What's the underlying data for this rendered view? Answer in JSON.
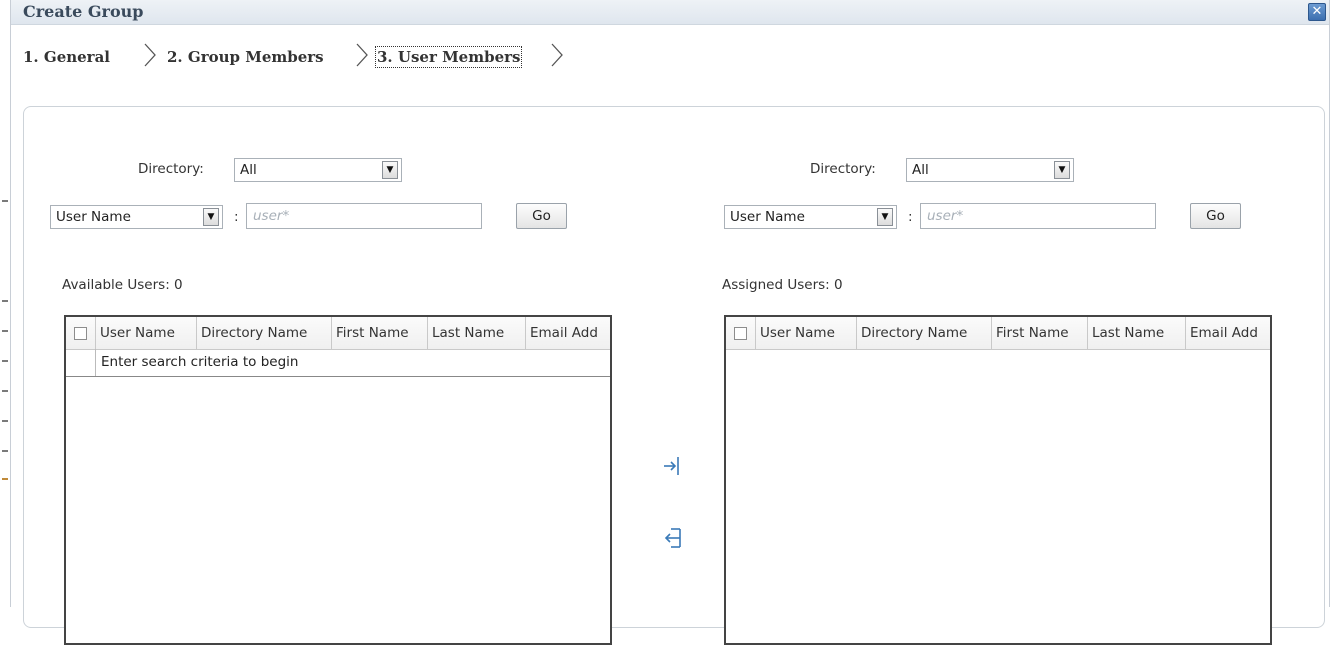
{
  "dialog": {
    "title": "Create Group",
    "close_label": "✕"
  },
  "wizard": {
    "steps": [
      {
        "label": "1. General"
      },
      {
        "label": "2. Group Members"
      },
      {
        "label": "3. User Members"
      }
    ]
  },
  "available": {
    "directory_label": "Directory:",
    "directory_value": "All",
    "search_field": "User Name",
    "colon": ":",
    "search_placeholder": "user*",
    "go_label": "Go",
    "count_label": "Available Users: 0",
    "columns": [
      "User Name",
      "Directory Name",
      "First Name",
      "Last Name",
      "Email Add"
    ],
    "empty_message": "Enter search criteria to begin"
  },
  "assigned": {
    "directory_label": "Directory:",
    "directory_value": "All",
    "search_field": "User Name",
    "colon": ":",
    "search_placeholder": "user*",
    "go_label": "Go",
    "count_label": "Assigned Users: 0",
    "columns": [
      "User Name",
      "Directory Name",
      "First Name",
      "Last Name",
      "Email Add"
    ]
  },
  "shuttle": {
    "add_icon": "move-right-icon",
    "remove_icon": "move-left-icon"
  },
  "colors": {
    "title_text": "#3a4a5c",
    "grid_border": "#444444",
    "placeholder": "#a8b0b8",
    "shuttle_icon": "#3a7ab8"
  }
}
